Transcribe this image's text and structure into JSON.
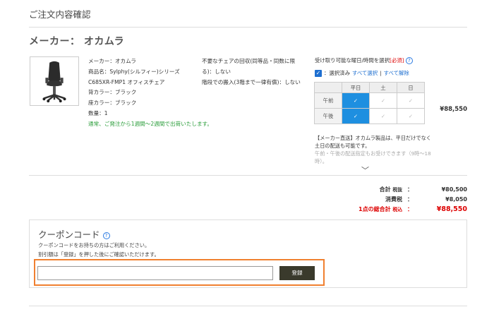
{
  "page": {
    "title": "ご注文内容確認"
  },
  "maker": {
    "label": "メーカー： オカムラ"
  },
  "product": {
    "image_icon": "office-chair-icon",
    "details": [
      "メーカー：オカムラ",
      "商品名：Sylphy(シルフィー)シリーズ",
      "C685XR-FMP1 オフィスチェア",
      "背カラー：ブラック",
      "座カラー：ブラック",
      "数量：1"
    ],
    "shipping": "通常、ご発注から1週間〜2週間で出荷いたします。",
    "options": [
      "不要なチェアの回収(同等品・同数に限る)：しない",
      "階段での搬入(3階まで一律有償)：しない"
    ],
    "price": "¥88,550"
  },
  "pickup": {
    "header": "受け取り可能な曜日/時間を選択",
    "required": "[必須]",
    "selected_label": "：選択済み",
    "select_all": "すべて選択",
    "separator": "|",
    "deselect_all": "すべて解除",
    "columns": [
      "",
      "平日",
      "土",
      "日"
    ],
    "rows": [
      {
        "label": "午前",
        "cells": [
          true,
          false,
          false
        ]
      },
      {
        "label": "午後",
        "cells": [
          true,
          false,
          false
        ]
      }
    ],
    "note1": "【メーカー直送】オカムラ製品は、平日だけでなく土日の配送も可能です。",
    "note2": "午前・午後の配送指定もお受けできます（9時〜18時）。"
  },
  "totals": {
    "subtotal_label": "合計",
    "subtotal_tax": "税抜",
    "subtotal": "¥80,500",
    "tax_label": "消費税",
    "tax": "¥8,050",
    "grand_label": "1点の総合計",
    "grand_tax": "税込",
    "grand": "¥88,550",
    "colon": "："
  },
  "coupon": {
    "title": "クーポンコード",
    "desc1": "クーポンコードをお持ちの方はご利用ください。",
    "desc2": "割引額は「登録」を押した後にご確認いただけます。",
    "input_value": "",
    "input_placeholder": "",
    "register_label": "登録",
    "highlight_color": "#f08030"
  },
  "colors": {
    "accent": "#1e8fe0",
    "price_red": "#dd0000",
    "ship_green": "#2a9d3a"
  }
}
